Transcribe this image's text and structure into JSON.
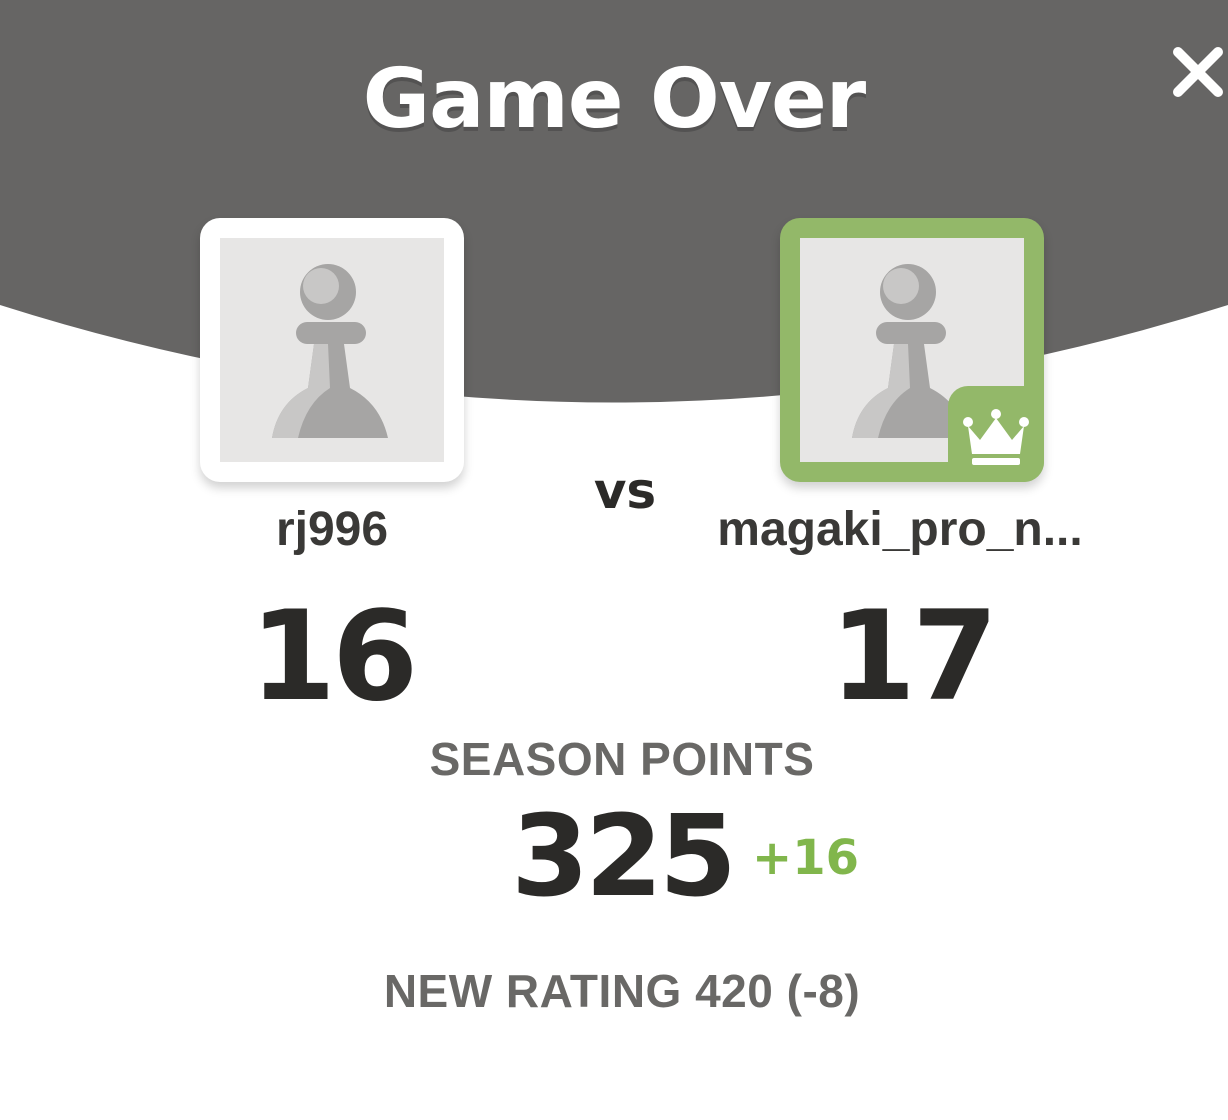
{
  "title": "Game Over",
  "close_symbol": "×",
  "vs_label": "vs",
  "players": [
    {
      "username": "rj996",
      "score": "16",
      "avatar_icon": "pawn-avatar-icon",
      "winner": false
    },
    {
      "username": "magaki_pro_n...",
      "score": "17",
      "avatar_icon": "pawn-avatar-icon",
      "winner": true,
      "badge_icon": "crown-icon"
    }
  ],
  "season": {
    "label": "SEASON POINTS",
    "value": "325",
    "delta": "+16"
  },
  "rating": {
    "text": "NEW RATING 420 (-8)"
  },
  "colors": {
    "header_bg": "#666564",
    "winner_green": "#93b869",
    "delta_green": "#81b64c",
    "text_dark": "#2b2a28",
    "text_gray": "#696866"
  }
}
